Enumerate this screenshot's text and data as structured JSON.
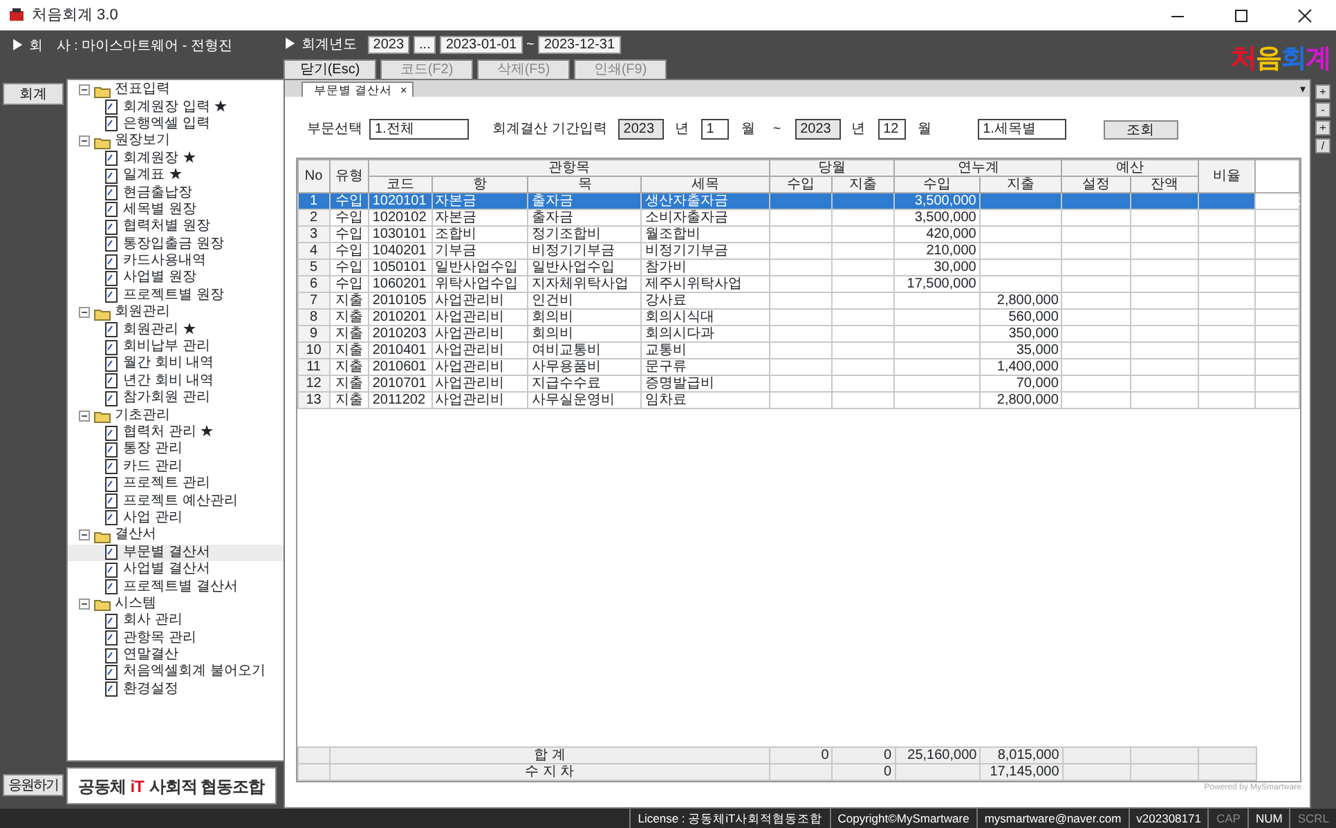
{
  "window": {
    "title": "처음회계 3.0"
  },
  "header": {
    "company_label": "▶ 회　사 : 마이스마트웨어 - 전형진",
    "year_label": "▶ 회계년도",
    "year": "2023",
    "year_button": "...",
    "date_from": "2023-01-01",
    "date_sep": "~",
    "date_to": "2023-12-31",
    "buttons": [
      {
        "label": "닫기(Esc)",
        "disabled": false
      },
      {
        "label": "코드(F2)",
        "disabled": true
      },
      {
        "label": "삭제(F5)",
        "disabled": true
      },
      {
        "label": "인쇄(F9)",
        "disabled": true
      }
    ],
    "logo": "처음회계"
  },
  "side_buttons": {
    "top": "회계",
    "bottom": "응원하기"
  },
  "tree": [
    {
      "label": "전표입력",
      "expanded": true,
      "children": [
        {
          "label": "회계원장 입력 ★",
          "selected": false
        },
        {
          "label": "은행엑셀 입력",
          "selected": false
        }
      ]
    },
    {
      "label": "원장보기",
      "expanded": true,
      "children": [
        {
          "label": "회계원장 ★",
          "selected": false
        },
        {
          "label": "일계표 ★",
          "selected": false
        },
        {
          "label": "현금출납장",
          "selected": false
        },
        {
          "label": "세목별 원장",
          "selected": false
        },
        {
          "label": "협력처별 원장",
          "selected": false
        },
        {
          "label": "통장입출금 원장",
          "selected": false
        },
        {
          "label": "카드사용내역",
          "selected": false
        },
        {
          "label": "사업별 원장",
          "selected": false
        },
        {
          "label": "프로젝트별 원장",
          "selected": false
        }
      ]
    },
    {
      "label": "회원관리",
      "expanded": true,
      "children": [
        {
          "label": "회원관리 ★",
          "selected": false
        },
        {
          "label": "회비납부 관리",
          "selected": false
        },
        {
          "label": "월간 회비 내역",
          "selected": false
        },
        {
          "label": "년간 회비 내역",
          "selected": false
        },
        {
          "label": "참가회원 관리",
          "selected": false
        }
      ]
    },
    {
      "label": "기초관리",
      "expanded": true,
      "children": [
        {
          "label": "협력처 관리 ★",
          "selected": false
        },
        {
          "label": "통장 관리",
          "selected": false
        },
        {
          "label": "카드 관리",
          "selected": false
        },
        {
          "label": "프로젝트 관리",
          "selected": false
        },
        {
          "label": "프로젝트 예산관리",
          "selected": false
        },
        {
          "label": "사업 관리",
          "selected": false
        }
      ]
    },
    {
      "label": "결산서",
      "expanded": true,
      "children": [
        {
          "label": "부문별 결산서",
          "selected": true
        },
        {
          "label": "사업별 결산서",
          "selected": false
        },
        {
          "label": "프로젝트별 결산서",
          "selected": false
        }
      ]
    },
    {
      "label": "시스템",
      "expanded": true,
      "children": [
        {
          "label": "회사 관리",
          "selected": false
        },
        {
          "label": "관항목 관리",
          "selected": false
        },
        {
          "label": "연말결산",
          "selected": false
        },
        {
          "label": "처음엑셀회계 불어오기",
          "selected": false
        },
        {
          "label": "환경설정",
          "selected": false
        }
      ]
    }
  ],
  "org_banner": {
    "before": "공동체",
    "mark": "iT",
    "after": "사회적 협동조합"
  },
  "tabs": [
    {
      "label": "부문별 결산서",
      "close": "×",
      "selected": true
    }
  ],
  "tab_menu": "▾",
  "right_tools": [
    "+",
    "-",
    "+",
    "/"
  ],
  "filters": {
    "dept_label": "부문선택",
    "dept": "1.전체",
    "period_label": "회계결산 기간입력",
    "from_year": "2023",
    "year_unit_1": "년",
    "from_month": "1",
    "month_unit_1": "월",
    "sep": "~",
    "to_year": "2023",
    "year_unit_2": "년",
    "to_month": "12",
    "month_unit_2": "월",
    "mode": "1.세목별",
    "search_button": "조회"
  },
  "table": {
    "groups": [
      "No",
      "유형",
      "관항목",
      "당월",
      "연누계",
      "예산",
      "비율"
    ],
    "columns": [
      "코드",
      "항",
      "목",
      "세목",
      "수입",
      "지출",
      "수입",
      "지출",
      "설정",
      "잔액"
    ],
    "rows": [
      {
        "no": "1",
        "type": "수입",
        "code": "1020101",
        "hang": "자본금",
        "mok": "출자금",
        "semok": "생산자출자금",
        "ytd_income": "3,500,000",
        "ytd_expense": "",
        "selected": true
      },
      {
        "no": "2",
        "type": "수입",
        "code": "1020102",
        "hang": "자본금",
        "mok": "출자금",
        "semok": "소비자출자금",
        "ytd_income": "3,500,000",
        "ytd_expense": "",
        "selected": false
      },
      {
        "no": "3",
        "type": "수입",
        "code": "1030101",
        "hang": "조합비",
        "mok": "정기조합비",
        "semok": "월조합비",
        "ytd_income": "420,000",
        "ytd_expense": "",
        "selected": false
      },
      {
        "no": "4",
        "type": "수입",
        "code": "1040201",
        "hang": "기부금",
        "mok": "비정기기부금",
        "semok": "비정기기부금",
        "ytd_income": "210,000",
        "ytd_expense": "",
        "selected": false
      },
      {
        "no": "5",
        "type": "수입",
        "code": "1050101",
        "hang": "일반사업수입",
        "mok": "일반사업수입",
        "semok": "참가비",
        "ytd_income": "30,000",
        "ytd_expense": "",
        "selected": false
      },
      {
        "no": "6",
        "type": "수입",
        "code": "1060201",
        "hang": "위탁사업수입",
        "mok": "지자체위탁사업",
        "semok": "제주시위탁사업",
        "ytd_income": "17,500,000",
        "ytd_expense": "",
        "selected": false
      },
      {
        "no": "7",
        "type": "지출",
        "code": "2010105",
        "hang": "사업관리비",
        "mok": "인건비",
        "semok": "강사료",
        "ytd_income": "",
        "ytd_expense": "2,800,000",
        "selected": false
      },
      {
        "no": "8",
        "type": "지출",
        "code": "2010201",
        "hang": "사업관리비",
        "mok": "회의비",
        "semok": "회의시식대",
        "ytd_income": "",
        "ytd_expense": "560,000",
        "selected": false
      },
      {
        "no": "9",
        "type": "지출",
        "code": "2010203",
        "hang": "사업관리비",
        "mok": "회의비",
        "semok": "회의시다과",
        "ytd_income": "",
        "ytd_expense": "350,000",
        "selected": false
      },
      {
        "no": "10",
        "type": "지출",
        "code": "2010401",
        "hang": "사업관리비",
        "mok": "여비교통비",
        "semok": "교통비",
        "ytd_income": "",
        "ytd_expense": "35,000",
        "selected": false
      },
      {
        "no": "11",
        "type": "지출",
        "code": "2010601",
        "hang": "사업관리비",
        "mok": "사무용품비",
        "semok": "문구류",
        "ytd_income": "",
        "ytd_expense": "1,400,000",
        "selected": false
      },
      {
        "no": "12",
        "type": "지출",
        "code": "2010701",
        "hang": "사업관리비",
        "mok": "지급수수료",
        "semok": "증명발급비",
        "ytd_income": "",
        "ytd_expense": "70,000",
        "selected": false
      },
      {
        "no": "13",
        "type": "지출",
        "code": "2011202",
        "hang": "사업관리비",
        "mok": "사무실운영비",
        "semok": "임차료",
        "ytd_income": "",
        "ytd_expense": "2,800,000",
        "selected": false
      }
    ],
    "totals": [
      {
        "label": "합 계",
        "month_income": "0",
        "month_expense": "0",
        "ytd_income": "25,160,000",
        "ytd_expense": "8,015,000"
      },
      {
        "label": "수 지 차",
        "month_expense": "0",
        "ytd_expense": "17,145,000"
      }
    ],
    "credit": "Powered by MySmartware"
  },
  "status_bar": {
    "items": [
      "License : 공동체iT사회적협동조합",
      "Copyright©MySmartware",
      "mysmartware@naver.com",
      "v202308171"
    ],
    "keys": [
      {
        "label": "CAP",
        "on": false
      },
      {
        "label": "NUM",
        "on": true
      },
      {
        "label": "SCRL",
        "on": false
      }
    ]
  }
}
